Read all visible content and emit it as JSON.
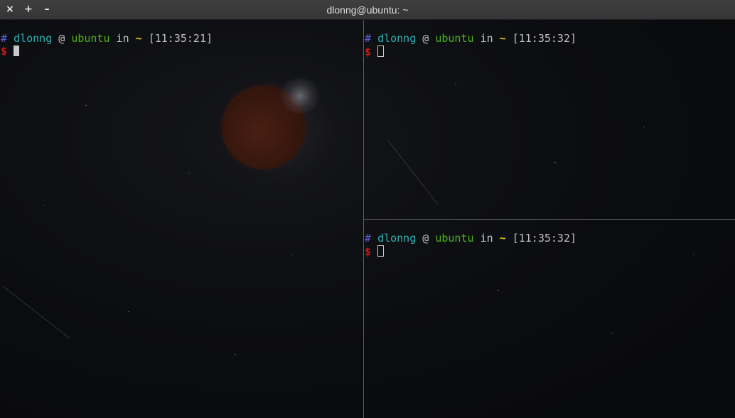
{
  "window": {
    "title": "dlonng@ubuntu: ~",
    "close_icon": "×",
    "maximize_icon": "+",
    "minimize_icon": "–"
  },
  "panes": {
    "left": {
      "hash": "#",
      "user": "dlonng",
      "at": "@",
      "host": "ubuntu",
      "in": "in",
      "dir": "~",
      "time": "[11:35:21]",
      "dollar": "$"
    },
    "top_right": {
      "hash": "#",
      "user": "dlonng",
      "at": "@",
      "host": "ubuntu",
      "in": "in",
      "dir": "~",
      "time": "[11:35:32]",
      "dollar": "$"
    },
    "bottom_right": {
      "hash": "#",
      "user": "dlonng",
      "at": "@",
      "host": "ubuntu",
      "in": "in",
      "dir": "~",
      "time": "[11:35:32]",
      "dollar": "$"
    }
  },
  "colors": {
    "hash": "#5f5fd7",
    "user": "#2fb1b1",
    "host": "#4cb31f",
    "tilde": "#d4c41c",
    "dollar": "#d21919",
    "titlebar": "#3a3a3a",
    "background": "#0b0c0f"
  }
}
